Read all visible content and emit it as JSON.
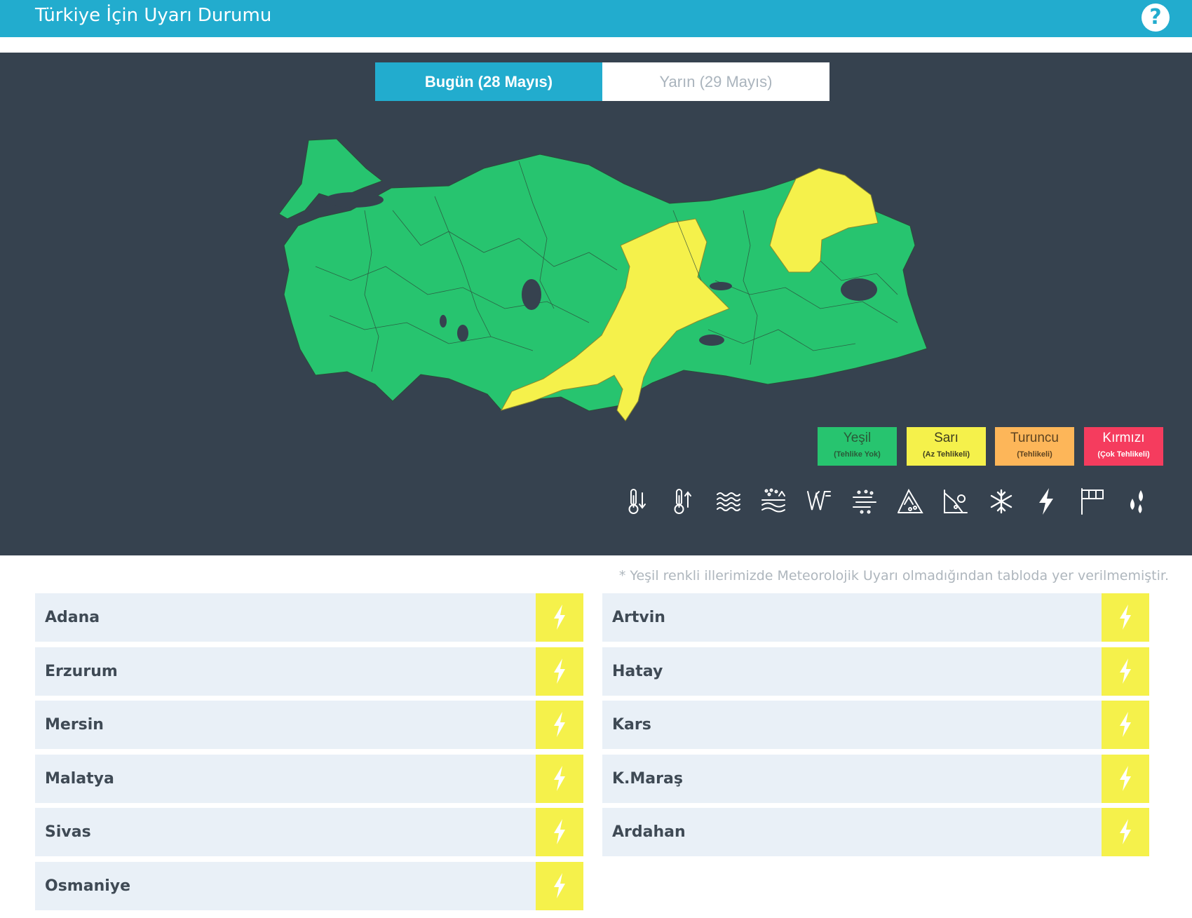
{
  "header": {
    "title": "Türkiye İçin Uyarı Durumu",
    "help_icon": "question-icon"
  },
  "tabs": [
    {
      "label": "Bugün (28 Mayıs)",
      "active": true
    },
    {
      "label": "Yarın (29 Mayıs)",
      "active": false
    }
  ],
  "map": {
    "default_color": "#27c46f",
    "warning_color": "#f5f14b",
    "lakes_color": "#36424f"
  },
  "legend": [
    {
      "name": "Yeşil",
      "desc": "(Tehlike Yok)",
      "color": "#27c46f"
    },
    {
      "name": "Sarı",
      "desc": "(Az Tehlikeli)",
      "color": "#f5f14b"
    },
    {
      "name": "Turuncu",
      "desc": "(Tehlikeli)",
      "color": "#fdb659"
    },
    {
      "name": "Kırmızı",
      "desc": "(Çok Tehlikeli)",
      "color": "#f53c5e"
    }
  ],
  "hazard_icons": [
    "cold-temperature-icon",
    "hot-temperature-icon",
    "fog-icon",
    "dust-icon",
    "wind-icon",
    "blizzard-icon",
    "avalanche-icon",
    "landslide-icon",
    "snow-icon",
    "thunderstorm-icon",
    "storm-flag-icon",
    "rain-icon"
  ],
  "note": "* Yeşil renkli illerimizde Meteorolojik Uyarı olmadığından tabloda yer verilmemiştir.",
  "warnings": {
    "left": [
      {
        "city": "Adana",
        "level": "yellow",
        "icon": "thunderstorm-icon"
      },
      {
        "city": "Erzurum",
        "level": "yellow",
        "icon": "thunderstorm-icon"
      },
      {
        "city": "Mersin",
        "level": "yellow",
        "icon": "thunderstorm-icon"
      },
      {
        "city": "Malatya",
        "level": "yellow",
        "icon": "thunderstorm-icon"
      },
      {
        "city": "Sivas",
        "level": "yellow",
        "icon": "thunderstorm-icon"
      },
      {
        "city": "Osmaniye",
        "level": "yellow",
        "icon": "thunderstorm-icon"
      }
    ],
    "right": [
      {
        "city": "Artvin",
        "level": "yellow",
        "icon": "thunderstorm-icon"
      },
      {
        "city": "Hatay",
        "level": "yellow",
        "icon": "thunderstorm-icon"
      },
      {
        "city": "Kars",
        "level": "yellow",
        "icon": "thunderstorm-icon"
      },
      {
        "city": "K.Maraş",
        "level": "yellow",
        "icon": "thunderstorm-icon"
      },
      {
        "city": "Ardahan",
        "level": "yellow",
        "icon": "thunderstorm-icon"
      }
    ]
  }
}
